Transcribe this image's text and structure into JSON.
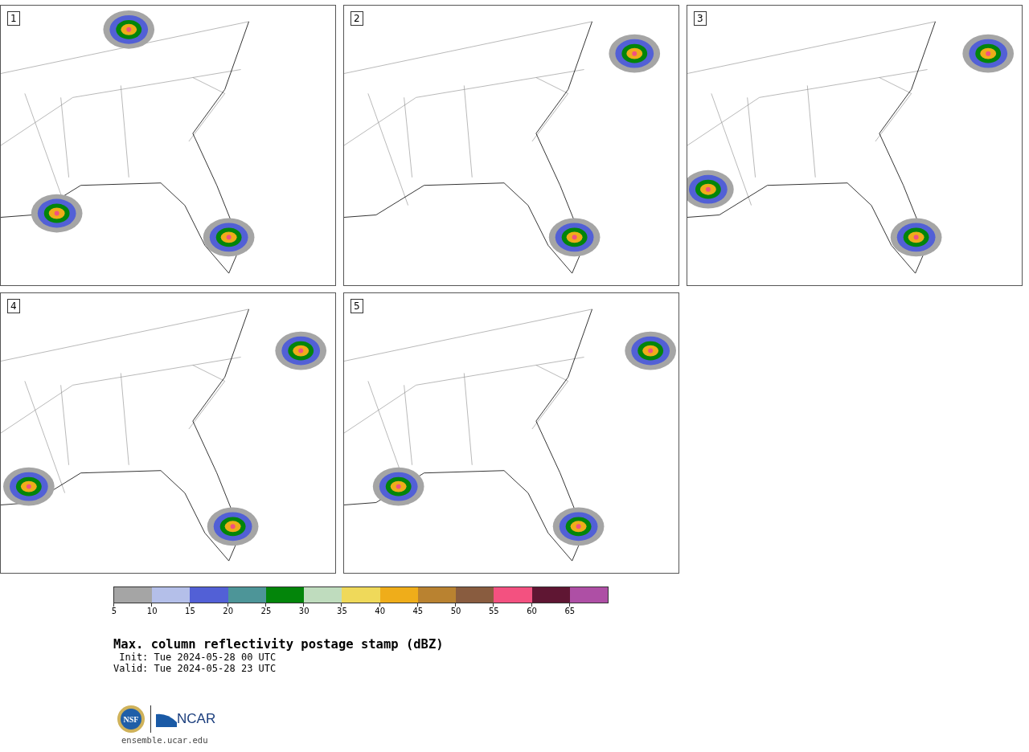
{
  "panels": [
    {
      "number": "1"
    },
    {
      "number": "2"
    },
    {
      "number": "3"
    },
    {
      "number": "4"
    },
    {
      "number": "5"
    }
  ],
  "colorbar": {
    "bins": [
      {
        "color": "#a5a5a5"
      },
      {
        "color": "#b4bfe9"
      },
      {
        "color": "#5260d6"
      },
      {
        "color": "#4d9598"
      },
      {
        "color": "#03850a"
      },
      {
        "color": "#bfdcbe"
      },
      {
        "color": "#efd95a"
      },
      {
        "color": "#efad1a"
      },
      {
        "color": "#b98230"
      },
      {
        "color": "#895c3f"
      },
      {
        "color": "#f35180"
      },
      {
        "color": "#5f1633"
      },
      {
        "color": "#ae4fa5"
      }
    ],
    "ticks": [
      "5",
      "10",
      "15",
      "20",
      "25",
      "30",
      "35",
      "40",
      "45",
      "50",
      "55",
      "60",
      "65"
    ]
  },
  "title": "Max. column reflectivity postage stamp (dBZ)",
  "init": " Init: Tue 2024-05-28 00 UTC",
  "valid": "Valid: Tue 2024-05-28 23 UTC",
  "logos": {
    "nsf": "NSF",
    "ncar": "NCAR"
  },
  "url": "ensemble.ucar.edu"
}
